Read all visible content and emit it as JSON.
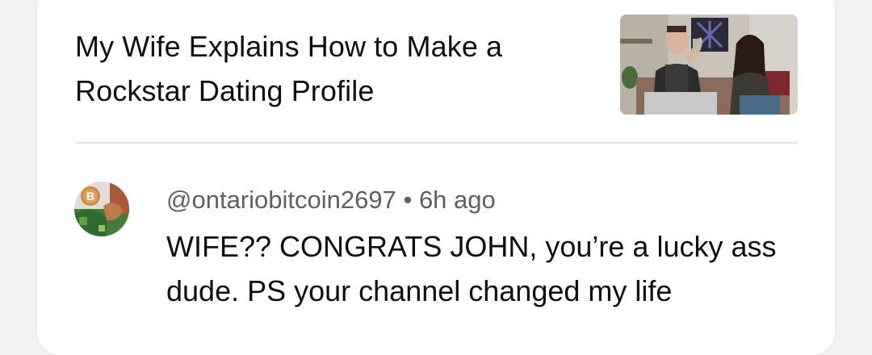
{
  "video": {
    "title": "My Wife Explains How to Make a Rockstar Dating Profile",
    "thumbnail": "video-thumbnail-image"
  },
  "comment": {
    "author": "@ontariobitcoin2697",
    "separator": "•",
    "time": "6h ago",
    "text": "WIFE?? CONGRATS JOHN, you’re a lucky ass dude. PS your channel changed my life",
    "avatar": "bitcoin-avatar-image"
  },
  "colors": {
    "primary_text": "#0f0f0f",
    "secondary_text": "#606060",
    "divider": "#e5e5e5",
    "card_bg": "#ffffff",
    "page_bg": "#f2f2f2"
  }
}
